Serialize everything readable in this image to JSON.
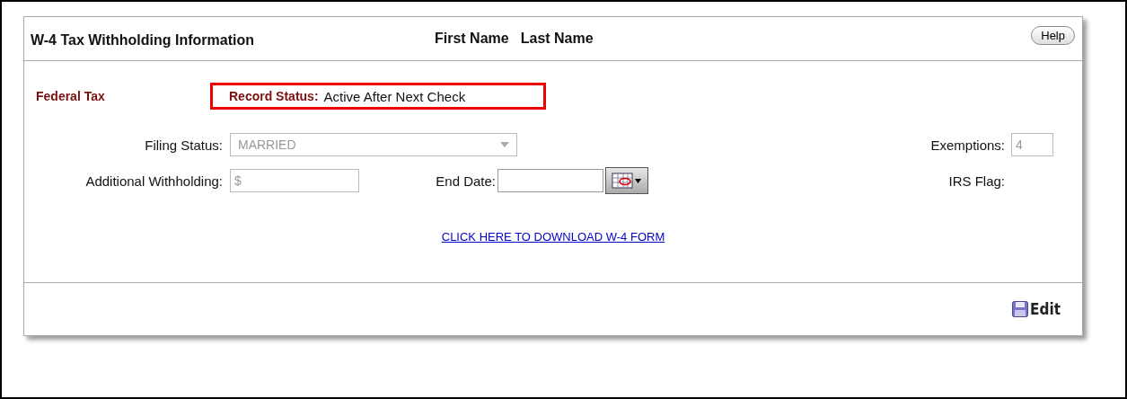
{
  "panel": {
    "title": "W-4 Tax Withholding Information",
    "first_name": "First Name",
    "last_name": "Last Name",
    "help_button": "Help"
  },
  "section": {
    "label": "Federal Tax",
    "record_status_label": "Record Status:",
    "record_status_value": "Active After Next Check"
  },
  "fields": {
    "filing_status": {
      "label": "Filing Status:",
      "value": "MARRIED",
      "disabled": true
    },
    "exemptions": {
      "label": "Exemptions:",
      "value": "4",
      "disabled": true
    },
    "additional_withholding": {
      "label": "Additional Withholding:",
      "value": "$",
      "disabled": true
    },
    "end_date": {
      "label": "End Date:"
    },
    "irs_flag": {
      "label": "IRS Flag:"
    }
  },
  "download_link": "CLICK HERE TO DOWNLOAD W-4 FORM",
  "footer": {
    "edit_button": "Edit"
  }
}
